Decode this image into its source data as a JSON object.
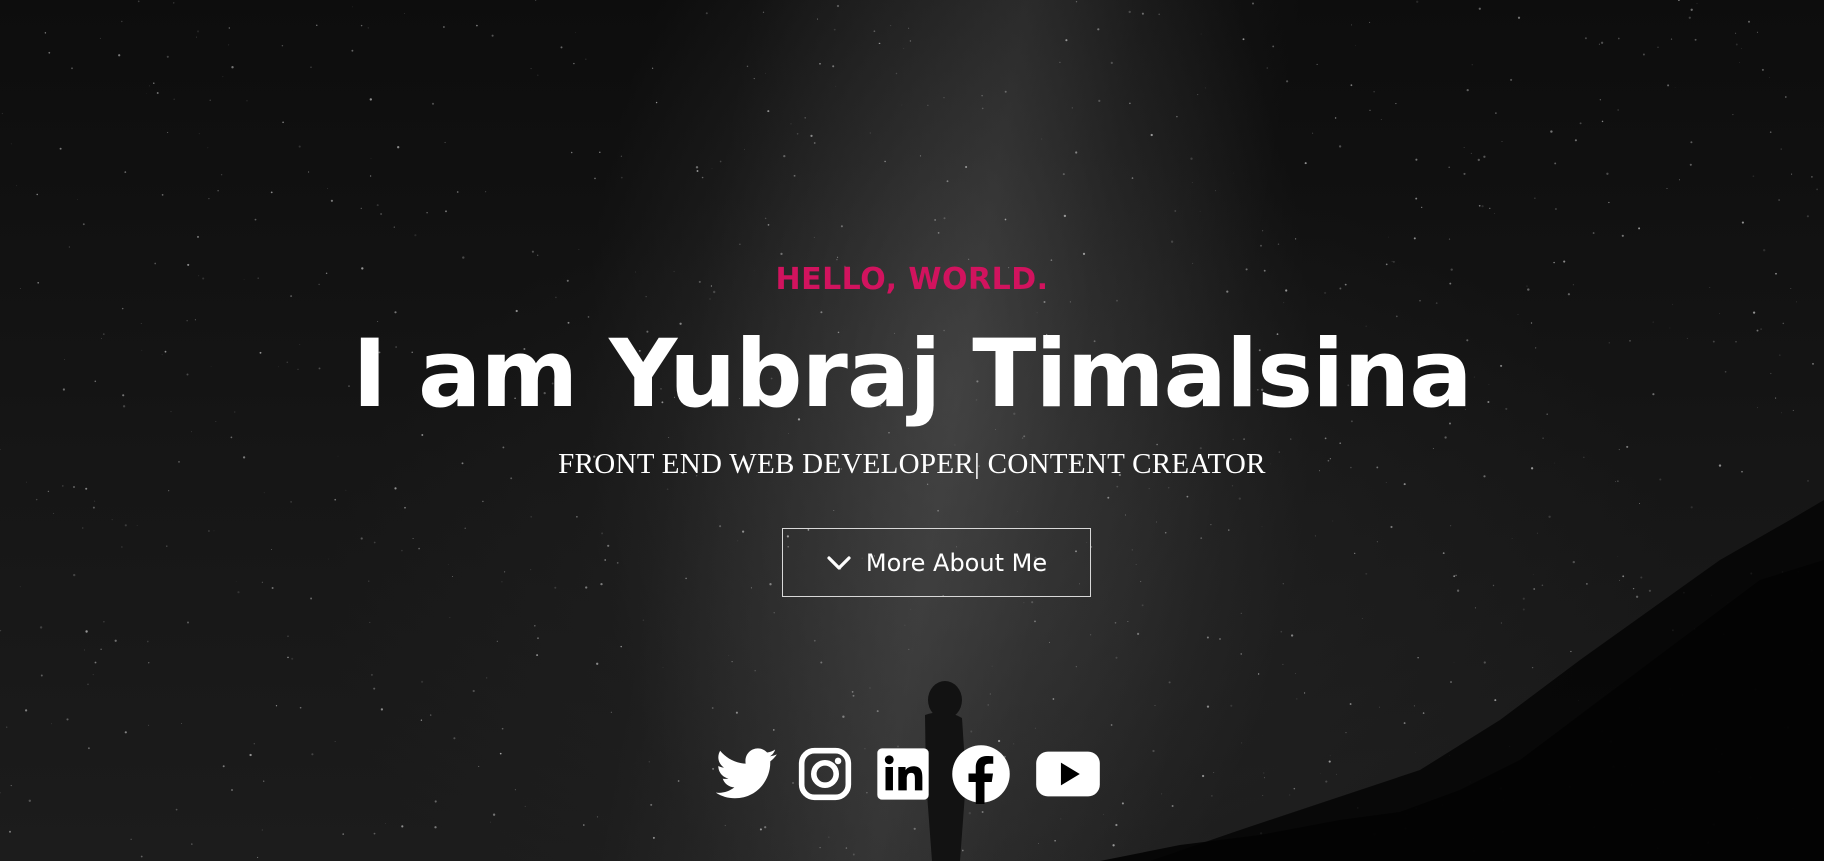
{
  "hero": {
    "greeting": "HELLO, WORLD.",
    "name": "I am Yubraj Timalsina",
    "tagline": "FRONT END WEB DEVELOPER| CONTENT CREATOR",
    "more_button_label": "More About Me",
    "more_button_icon": "chevron-down-icon"
  },
  "socials": [
    {
      "icon": "twitter-icon"
    },
    {
      "icon": "instagram-icon"
    },
    {
      "icon": "linkedin-icon"
    },
    {
      "icon": "facebook-icon"
    },
    {
      "icon": "youtube-icon"
    }
  ],
  "colors": {
    "accent": "#d1135e",
    "text": "#ffffff",
    "background": "#0b0b0b"
  }
}
